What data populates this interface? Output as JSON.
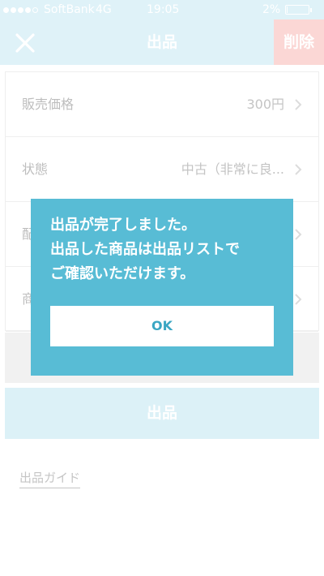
{
  "status_bar": {
    "carrier": "SoftBank",
    "network": "4G",
    "time": "19:05",
    "battery_text": "2%",
    "battery_level": 0.02,
    "signal_bars_filled": 4,
    "signal_bars_total": 5
  },
  "nav": {
    "title": "出品",
    "delete_label": "削除",
    "close_icon": "close-icon"
  },
  "form": {
    "rows": [
      {
        "label": "販売価格",
        "value": "300円"
      },
      {
        "label": "状態",
        "value": "中古（非常に良..."
      },
      {
        "label": "配",
        "value": ""
      },
      {
        "label": "商",
        "value": ""
      }
    ]
  },
  "submit_label": "出品",
  "guide_label": "出品ガイド",
  "modal": {
    "lines": [
      "出品が完了しました。",
      "出品した商品は出品リストで",
      "ご確認いただけます。"
    ],
    "ok_label": "OK"
  },
  "colors": {
    "header_bg": "#dff2f8",
    "delete_bg": "#fbd7d5",
    "modal_bg": "#58bcd5",
    "ok_text": "#3aa6c3"
  }
}
